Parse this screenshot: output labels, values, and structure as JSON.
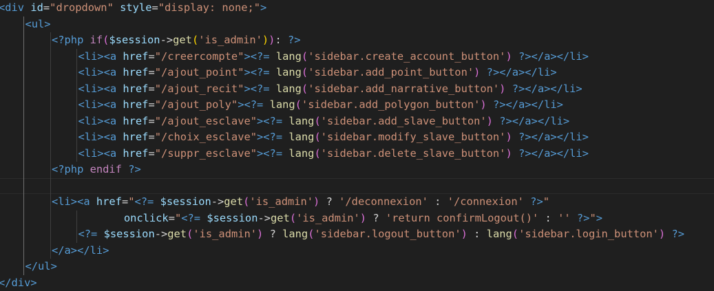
{
  "editor": {
    "language": "php",
    "theme_colors": {
      "background": "#1f1f1f",
      "tag": "#569cd6",
      "attribute": "#9cdcfe",
      "string": "#ce9178",
      "keyword": "#c586c0",
      "function": "#dcdcaa",
      "variable": "#9cdcfe",
      "punctuation": "#d4d4d4",
      "bracket_pair_1": "#da70d6",
      "bracket_pair_2": "#ffd700"
    },
    "highlighted_line": 11,
    "lines": [
      {
        "indent": 0,
        "tokens": [
          [
            "tag",
            "<div "
          ],
          [
            "attr",
            "id"
          ],
          [
            "punc",
            "="
          ],
          [
            "str",
            "\"dropdown\""
          ],
          [
            "punc",
            " "
          ],
          [
            "attr",
            "style"
          ],
          [
            "punc",
            "="
          ],
          [
            "str",
            "\"display: none;\""
          ],
          [
            "tag",
            ">"
          ]
        ]
      },
      {
        "indent": 1,
        "tokens": [
          [
            "tag",
            "<ul>"
          ]
        ]
      },
      {
        "indent": 2,
        "tokens": [
          [
            "php",
            "<?php "
          ],
          [
            "kw",
            "if"
          ],
          [
            "brace",
            "("
          ],
          [
            "var",
            "$session"
          ],
          [
            "punc",
            "->"
          ],
          [
            "fn",
            "get"
          ],
          [
            "brace2",
            "("
          ],
          [
            "str",
            "'is_admin'"
          ],
          [
            "brace2",
            ")"
          ],
          [
            "brace",
            ")"
          ],
          [
            "punc",
            ": "
          ],
          [
            "php",
            "?>"
          ]
        ]
      },
      {
        "indent": 3,
        "tokens": [
          [
            "tag",
            "<li><a "
          ],
          [
            "attr",
            "href"
          ],
          [
            "punc",
            "="
          ],
          [
            "str",
            "\"/creercompte\""
          ],
          [
            "tag",
            ">"
          ],
          [
            "php",
            "<?= "
          ],
          [
            "fn",
            "lang"
          ],
          [
            "brace",
            "("
          ],
          [
            "str",
            "'sidebar.create_account_button'"
          ],
          [
            "brace",
            ")"
          ],
          [
            "punc",
            " "
          ],
          [
            "php",
            "?>"
          ],
          [
            "tag",
            "</a></li>"
          ]
        ]
      },
      {
        "indent": 3,
        "tokens": [
          [
            "tag",
            "<li><a "
          ],
          [
            "attr",
            "href"
          ],
          [
            "punc",
            "="
          ],
          [
            "str",
            "\"/ajout_point\""
          ],
          [
            "tag",
            ">"
          ],
          [
            "php",
            "<?= "
          ],
          [
            "fn",
            "lang"
          ],
          [
            "brace",
            "("
          ],
          [
            "str",
            "'sidebar.add_point_button'"
          ],
          [
            "brace",
            ")"
          ],
          [
            "punc",
            " "
          ],
          [
            "php",
            "?>"
          ],
          [
            "tag",
            "</a></li>"
          ]
        ]
      },
      {
        "indent": 3,
        "tokens": [
          [
            "tag",
            "<li><a "
          ],
          [
            "attr",
            "href"
          ],
          [
            "punc",
            "="
          ],
          [
            "str",
            "\"/ajout_recit\""
          ],
          [
            "tag",
            ">"
          ],
          [
            "php",
            "<?= "
          ],
          [
            "fn",
            "lang"
          ],
          [
            "brace",
            "("
          ],
          [
            "str",
            "'sidebar.add_narrative_button'"
          ],
          [
            "brace",
            ")"
          ],
          [
            "punc",
            " "
          ],
          [
            "php",
            "?>"
          ],
          [
            "tag",
            "</a></li>"
          ]
        ]
      },
      {
        "indent": 3,
        "tokens": [
          [
            "tag",
            "<li><a "
          ],
          [
            "attr",
            "href"
          ],
          [
            "punc",
            "="
          ],
          [
            "str",
            "\"/ajout_poly\""
          ],
          [
            "tag",
            ">"
          ],
          [
            "php",
            "<?= "
          ],
          [
            "fn",
            "lang"
          ],
          [
            "brace",
            "("
          ],
          [
            "str",
            "'sidebar.add_polygon_button'"
          ],
          [
            "brace",
            ")"
          ],
          [
            "punc",
            " "
          ],
          [
            "php",
            "?>"
          ],
          [
            "tag",
            "</a></li>"
          ]
        ]
      },
      {
        "indent": 3,
        "tokens": [
          [
            "tag",
            "<li><a "
          ],
          [
            "attr",
            "href"
          ],
          [
            "punc",
            "="
          ],
          [
            "str",
            "\"/ajout_esclave\""
          ],
          [
            "tag",
            ">"
          ],
          [
            "php",
            "<?= "
          ],
          [
            "fn",
            "lang"
          ],
          [
            "brace",
            "("
          ],
          [
            "str",
            "'sidebar.add_slave_button'"
          ],
          [
            "brace",
            ")"
          ],
          [
            "punc",
            " "
          ],
          [
            "php",
            "?>"
          ],
          [
            "tag",
            "</a></li>"
          ]
        ]
      },
      {
        "indent": 3,
        "tokens": [
          [
            "tag",
            "<li><a "
          ],
          [
            "attr",
            "href"
          ],
          [
            "punc",
            "="
          ],
          [
            "str",
            "\"/choix_esclave\""
          ],
          [
            "tag",
            ">"
          ],
          [
            "php",
            "<?= "
          ],
          [
            "fn",
            "lang"
          ],
          [
            "brace",
            "("
          ],
          [
            "str",
            "'sidebar.modify_slave_button'"
          ],
          [
            "brace",
            ")"
          ],
          [
            "punc",
            " "
          ],
          [
            "php",
            "?>"
          ],
          [
            "tag",
            "</a></li>"
          ]
        ]
      },
      {
        "indent": 3,
        "tokens": [
          [
            "tag",
            "<li><a "
          ],
          [
            "attr",
            "href"
          ],
          [
            "punc",
            "="
          ],
          [
            "str",
            "\"/suppr_esclave\""
          ],
          [
            "tag",
            ">"
          ],
          [
            "php",
            "<?= "
          ],
          [
            "fn",
            "lang"
          ],
          [
            "brace",
            "("
          ],
          [
            "str",
            "'sidebar.delete_slave_button'"
          ],
          [
            "brace",
            ")"
          ],
          [
            "punc",
            " "
          ],
          [
            "php",
            "?>"
          ],
          [
            "tag",
            "</a></li>"
          ]
        ]
      },
      {
        "indent": 2,
        "tokens": [
          [
            "php",
            "<?php "
          ],
          [
            "kw",
            "endif"
          ],
          [
            "punc",
            " "
          ],
          [
            "php",
            "?>"
          ]
        ]
      },
      {
        "indent": 0,
        "tokens": []
      },
      {
        "indent": 2,
        "tokens": [
          [
            "tag",
            "<li><a "
          ],
          [
            "attr",
            "href"
          ],
          [
            "punc",
            "="
          ],
          [
            "str",
            "\""
          ],
          [
            "php",
            "<?= "
          ],
          [
            "var",
            "$session"
          ],
          [
            "punc",
            "->"
          ],
          [
            "fn",
            "get"
          ],
          [
            "brace",
            "("
          ],
          [
            "str",
            "'is_admin'"
          ],
          [
            "brace",
            ")"
          ],
          [
            "punc",
            " ? "
          ],
          [
            "str",
            "'/deconnexion'"
          ],
          [
            "punc",
            " : "
          ],
          [
            "str",
            "'/connexion'"
          ],
          [
            "punc",
            " "
          ],
          [
            "php",
            "?>"
          ],
          [
            "str",
            "\""
          ]
        ]
      },
      {
        "indent": 4,
        "extra": "   ",
        "tokens": [
          [
            "attr",
            "onclick"
          ],
          [
            "punc",
            "="
          ],
          [
            "str",
            "\""
          ],
          [
            "php",
            "<?= "
          ],
          [
            "var",
            "$session"
          ],
          [
            "punc",
            "->"
          ],
          [
            "fn",
            "get"
          ],
          [
            "brace",
            "("
          ],
          [
            "str",
            "'is_admin'"
          ],
          [
            "brace",
            ")"
          ],
          [
            "punc",
            " ? "
          ],
          [
            "str",
            "'return confirmLogout()'"
          ],
          [
            "punc",
            " : "
          ],
          [
            "str",
            "''"
          ],
          [
            "punc",
            " "
          ],
          [
            "php",
            "?>"
          ],
          [
            "str",
            "\""
          ],
          [
            "tag",
            ">"
          ]
        ]
      },
      {
        "indent": 3,
        "tokens": [
          [
            "php",
            "<?= "
          ],
          [
            "var",
            "$session"
          ],
          [
            "punc",
            "->"
          ],
          [
            "fn",
            "get"
          ],
          [
            "brace",
            "("
          ],
          [
            "str",
            "'is_admin'"
          ],
          [
            "brace",
            ")"
          ],
          [
            "punc",
            " ? "
          ],
          [
            "fn",
            "lang"
          ],
          [
            "brace",
            "("
          ],
          [
            "str",
            "'sidebar.logout_button'"
          ],
          [
            "brace",
            ")"
          ],
          [
            "punc",
            " : "
          ],
          [
            "fn",
            "lang"
          ],
          [
            "brace",
            "("
          ],
          [
            "str",
            "'sidebar.login_button'"
          ],
          [
            "brace",
            ")"
          ],
          [
            "punc",
            " "
          ],
          [
            "php",
            "?>"
          ]
        ]
      },
      {
        "indent": 2,
        "tokens": [
          [
            "tag",
            "</a></li>"
          ]
        ]
      },
      {
        "indent": 1,
        "tokens": [
          [
            "tag",
            "</ul>"
          ]
        ]
      },
      {
        "indent": 0,
        "tokens": [
          [
            "tag",
            "</div>"
          ]
        ]
      }
    ]
  }
}
